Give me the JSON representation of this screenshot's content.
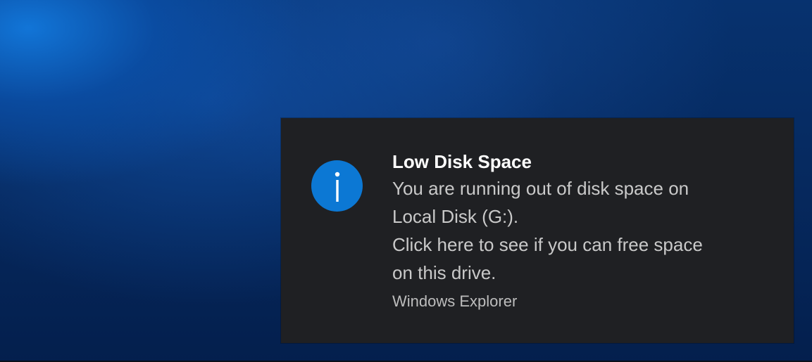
{
  "notification": {
    "icon": "info-icon",
    "title": "Low Disk Space",
    "message_lines": [
      "You are running out of disk space on",
      "Local Disk (G:).",
      "Click here to see if you can free space",
      "on this drive."
    ],
    "source": "Windows Explorer"
  },
  "colors": {
    "toast_background": "#1f2023",
    "icon_accent": "#0c78d4",
    "title_text": "#ffffff",
    "body_text": "#c9c9c9"
  }
}
